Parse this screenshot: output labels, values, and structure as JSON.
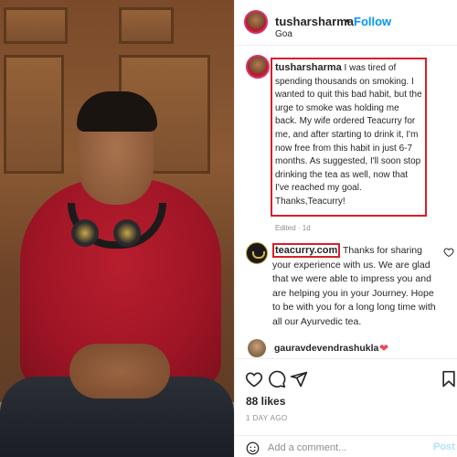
{
  "post": {
    "photo_description_icon": "photo-of-man-in-red-hoodie",
    "header": {
      "username": "tusharsharma",
      "separator": "•",
      "follow_label": "Follow",
      "location": "Goa"
    },
    "caption": {
      "username": "tusharsharma",
      "text": "I was tired of spending thousands on smoking. I wanted to quit this bad habit, but the urge to smoke was holding me back. My wife ordered Teacurry for me, and after starting to drink it, I'm now free from this habit in just 6-7 months. As suggested, I'll soon stop drinking the tea as well, now that I've reached my goal. Thanks,Teacurry!",
      "meta": "Edited · 1d"
    },
    "reply": {
      "username": "teacurry.com",
      "text": "Thanks for sharing your experience with us. We are glad that we were able to impress you and are helping you in your Journey. Hope to be with you for a long long time with all our Ayurvedic tea."
    },
    "liker": {
      "username": "gauravdevendrashukla",
      "heart": "❤"
    },
    "likes": "88 likes",
    "date": "1 DAY AGO",
    "add_comment": {
      "placeholder": "Add a comment...",
      "post_label": "Post"
    },
    "colors": {
      "accent": "#0095f6",
      "highlight_box": "#d81f2a",
      "heart": "#ed4956"
    }
  }
}
